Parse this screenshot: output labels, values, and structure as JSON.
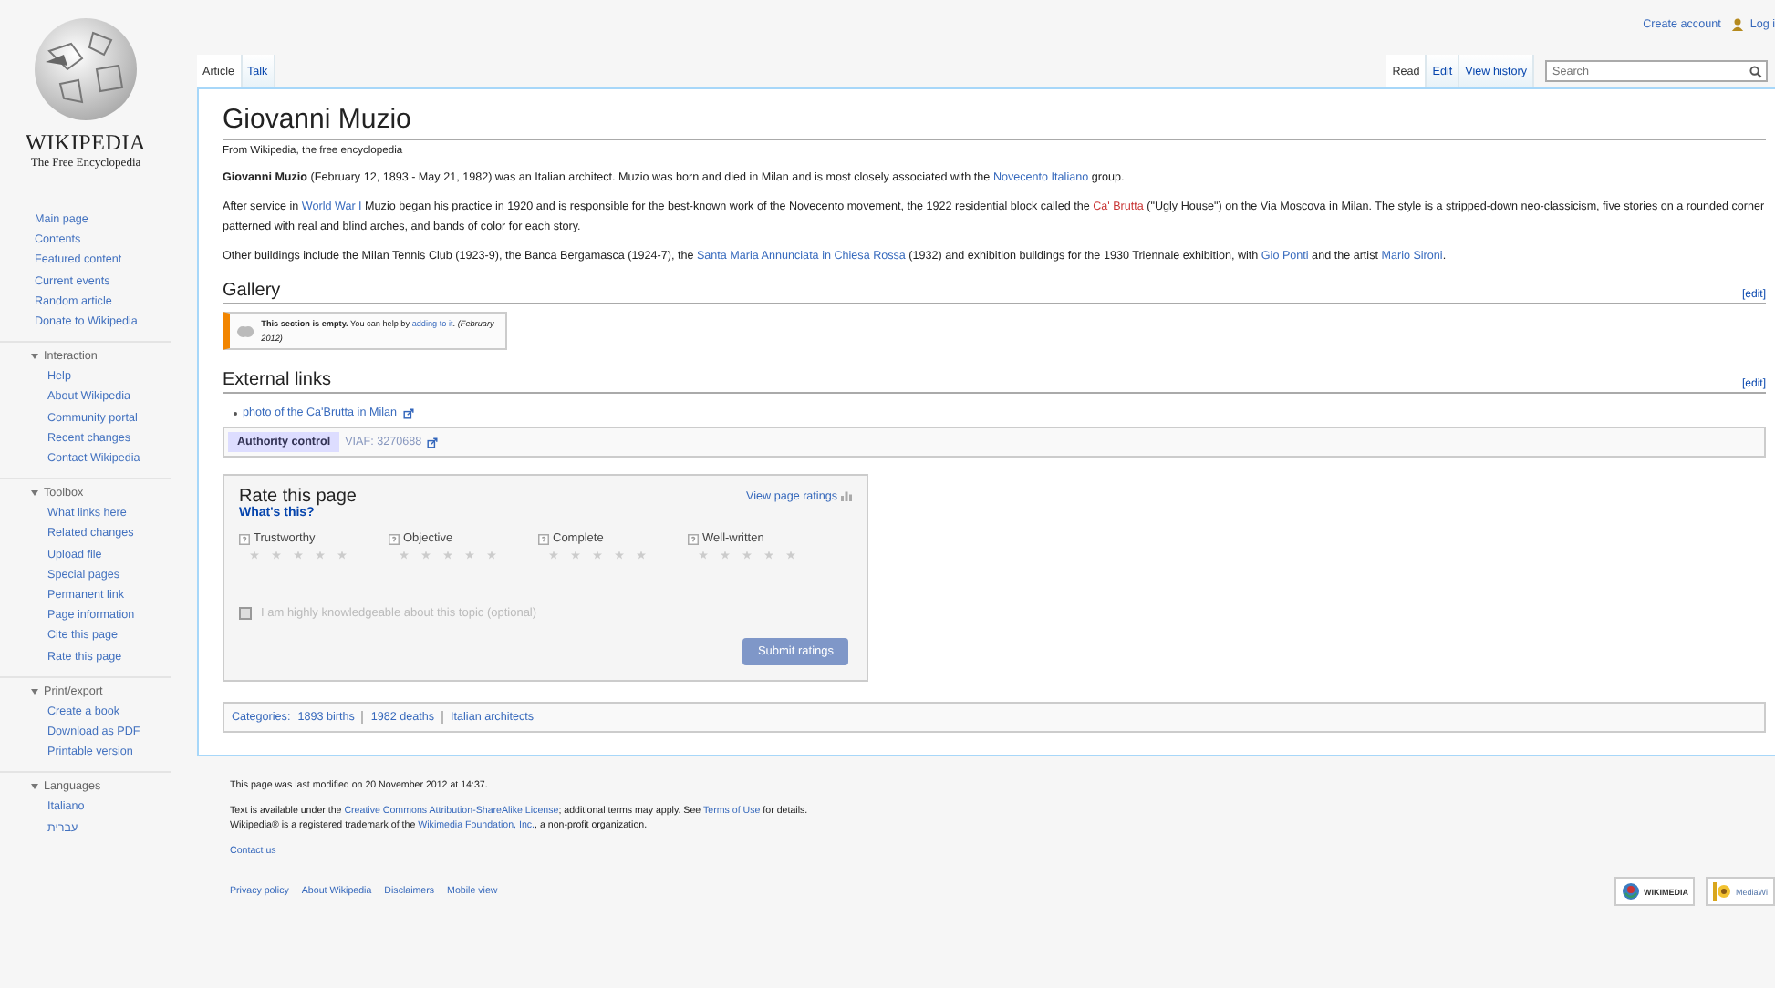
{
  "header": {
    "personal": [
      {
        "label": "Create account",
        "kind": "link"
      },
      {
        "label": "Log i",
        "kind": "user"
      }
    ]
  },
  "logo": {
    "wordmark": "WIKIPEDIA",
    "tagline": "The Free Encyclopedia"
  },
  "sidebar": {
    "main": [
      "Main page",
      "Contents",
      "Featured content",
      "Current events",
      "Random article",
      "Donate to Wikipedia"
    ],
    "sections": [
      {
        "heading": "Interaction",
        "expanded": true,
        "items": [
          "Help",
          "About Wikipedia",
          "Community portal",
          "Recent changes",
          "Contact Wikipedia"
        ]
      },
      {
        "heading": "Toolbox",
        "expanded": true,
        "items": [
          "What links here",
          "Related changes",
          "Upload file",
          "Special pages",
          "Permanent link",
          "Page information",
          "Cite this page",
          "Rate this page"
        ]
      },
      {
        "heading": "Print/export",
        "expanded": true,
        "items": [
          "Create a book",
          "Download as PDF",
          "Printable version"
        ]
      },
      {
        "heading": "Languages",
        "expanded": true,
        "items": [
          "Italiano",
          "עברית"
        ]
      }
    ]
  },
  "tabs_left": [
    {
      "label": "Article",
      "selected": true
    },
    {
      "label": "Talk",
      "selected": false
    }
  ],
  "tabs_right": [
    {
      "label": "Read",
      "selected": true
    },
    {
      "label": "Edit",
      "selected": false
    },
    {
      "label": "View history",
      "selected": false
    }
  ],
  "search": {
    "placeholder": "Search"
  },
  "article": {
    "title": "Giovanni Muzio",
    "tagline": "From Wikipedia, the free encyclopedia",
    "paragraphs": [
      [
        {
          "kind": "text",
          "text": "**Giovanni Muzio** (February 12, 1893 - May 21, 1982) was an Italian architect. Muzio was born and died in Milan and is most closely associated with the "
        },
        {
          "kind": "link",
          "text": "Novecento Italiano"
        },
        {
          "kind": "text",
          "text": " group."
        }
      ],
      [
        {
          "kind": "text",
          "text": "After service in "
        },
        {
          "kind": "link",
          "text": "World War I"
        },
        {
          "kind": "text",
          "text": " Muzio began his practice in 1920 and is responsible for the best-known work of the Novecento movement, the 1922 residential block called the "
        },
        {
          "kind": "redlink",
          "text": "Ca' Brutta"
        },
        {
          "kind": "text",
          "text": " (\"Ugly House\") on the Via Moscova in Milan. The style is a stripped-down neo-classicism, five stories on a rounded corner patterned with real and blind arches, and bands of color for each story."
        }
      ],
      [
        {
          "kind": "text",
          "text": "Other buildings include the Milan Tennis Club (1923-9), the Banca Bergamasca (1924-7), the "
        },
        {
          "kind": "link",
          "text": "Santa Maria Annunciata in Chiesa Rossa"
        },
        {
          "kind": "text",
          "text": " (1932) and exhibition buildings for the 1930 Triennale exhibition, with "
        },
        {
          "kind": "link",
          "text": "Gio Ponti"
        },
        {
          "kind": "text",
          "text": " and the artist "
        },
        {
          "kind": "link",
          "text": "Mario Sironi"
        },
        {
          "kind": "text",
          "text": "."
        }
      ]
    ],
    "gallery": {
      "heading": "Gallery",
      "edit_link": "[edit]",
      "notice": [
        {
          "kind": "text",
          "text": "**This section is empty.** You can help by "
        },
        {
          "kind": "link",
          "text": "adding to it"
        },
        {
          "kind": "text",
          "text": ". *(February 2012)*"
        }
      ]
    },
    "external": {
      "heading": "External links",
      "edit_link": "[edit]",
      "links": [
        "photo of the Ca'Brutta in Milan"
      ],
      "authority": {
        "label": "Authority control",
        "value": "VIAF: 3270688"
      }
    },
    "rating": {
      "title": "Rate this page",
      "help": "What's this?",
      "view_link": "View page ratings",
      "criteria": [
        {
          "label": "Trustworthy",
          "stars": 0
        },
        {
          "label": "Objective",
          "stars": 0
        },
        {
          "label": "Complete",
          "stars": 0
        },
        {
          "label": "Well-written",
          "stars": 0
        }
      ],
      "expert": {
        "label": "I am highly knowledgeable about this topic (optional)",
        "checked": false
      },
      "submit": {
        "label": "Submit ratings",
        "disabled": true
      }
    },
    "categories": {
      "label": "Categories:",
      "items": [
        "1893 births",
        "1982 deaths",
        "Italian architects"
      ]
    }
  },
  "footer": {
    "modified": "This page was last modified on 20 November 2012 at 14:37.",
    "license": [
      {
        "kind": "text",
        "text": "Text is available under the "
      },
      {
        "kind": "link",
        "text": "Creative Commons Attribution-ShareAlike License"
      },
      {
        "kind": "text",
        "text": "; additional terms may apply. See "
      },
      {
        "kind": "link",
        "text": "Terms of Use"
      },
      {
        "kind": "text",
        "text": " for details."
      }
    ],
    "trademark": [
      {
        "kind": "text",
        "text": "Wikipedia® is a registered trademark of the "
      },
      {
        "kind": "link",
        "text": "Wikimedia Foundation, Inc."
      },
      {
        "kind": "text",
        "text": ", a non-profit organization."
      }
    ],
    "contact": "Contact us",
    "links": [
      "Privacy policy",
      "About Wikipedia",
      "Disclaimers",
      "Mobile view"
    ],
    "badges": [
      {
        "kind": "wikimedia",
        "label": "WIKIMEDIA"
      },
      {
        "kind": "mediawiki",
        "label": "MediaWi"
      }
    ]
  }
}
